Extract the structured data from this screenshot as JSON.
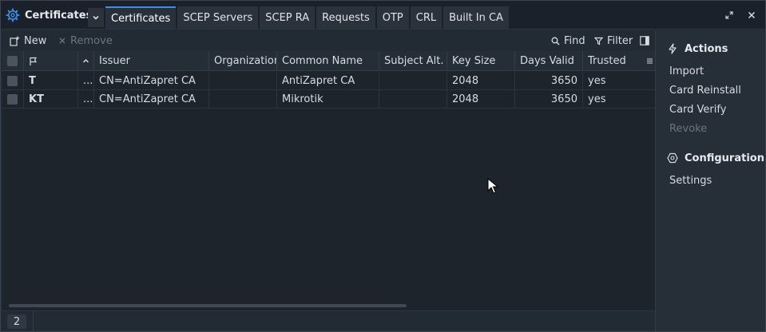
{
  "titlebar": {
    "app_title": "Certificates",
    "dropdown_icon": "chevron-down-icon",
    "tabs": [
      {
        "label": "Certificates",
        "active": true
      },
      {
        "label": "SCEP Servers",
        "active": false
      },
      {
        "label": "SCEP RA",
        "active": false
      },
      {
        "label": "Requests",
        "active": false
      },
      {
        "label": "OTP",
        "active": false
      },
      {
        "label": "CRL",
        "active": false
      },
      {
        "label": "Built In CA",
        "active": false
      }
    ],
    "restore_icon": "restore-icon",
    "close_icon": "close-icon"
  },
  "toolbar": {
    "new_label": "New",
    "remove_label": "Remove",
    "find_label": "Find",
    "filter_label": "Filter"
  },
  "table": {
    "columns": [
      "",
      "",
      "",
      "Issuer",
      "Organization",
      "Common Name",
      "Subject Alt. ...",
      "Key Size",
      "Days Valid",
      "Trusted"
    ],
    "rows": [
      {
        "flag": "T",
        "dots": "...",
        "issuer": "CN=AntiZapret CA",
        "organization": "",
        "common_name": "AntiZapret CA",
        "subject_alt": "",
        "key_size": "2048",
        "days_valid": "3650",
        "trusted": "yes"
      },
      {
        "flag": "KT",
        "dots": "...",
        "issuer": "CN=AntiZapret CA",
        "organization": "",
        "common_name": "Mikrotik",
        "subject_alt": "",
        "key_size": "2048",
        "days_valid": "3650",
        "trusted": "yes"
      }
    ]
  },
  "status": {
    "count": "2"
  },
  "panel": {
    "actions_title": "Actions",
    "actions": [
      {
        "label": "Import",
        "enabled": true
      },
      {
        "label": "Card Reinstall",
        "enabled": true
      },
      {
        "label": "Card Verify",
        "enabled": true
      },
      {
        "label": "Revoke",
        "enabled": false
      }
    ],
    "configuration_title": "Configuration",
    "configuration_items": [
      {
        "label": "Settings",
        "enabled": true
      }
    ]
  },
  "colors": {
    "accent": "#3a8ee6",
    "background": "#1d242c",
    "panel": "#262e38"
  }
}
